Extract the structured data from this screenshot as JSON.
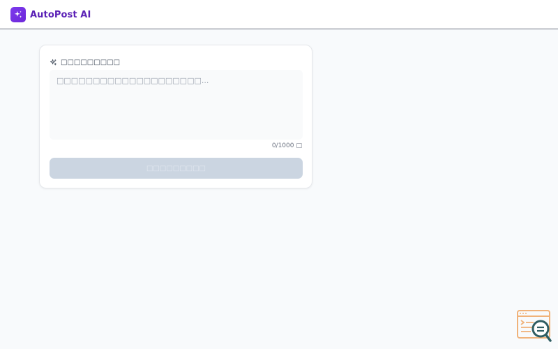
{
  "app": {
    "name": "AutoPost AI",
    "brand_color": "#6d28d9",
    "logo_icon": "sparkles-icon"
  },
  "composer": {
    "label": "□□□□□□□□□",
    "label_icon": "sparkles-icon",
    "placeholder": "□□□□□□□□□□□□□□□□□□□□...",
    "value": "",
    "char_count": "0/1000",
    "char_count_suffix": "□",
    "generate_label": "□□□□□□□□□",
    "generate_disabled": true,
    "button_color": "#cbd5e1"
  },
  "widget": {
    "icon": "code-search-icon",
    "color": "#f0b27a"
  }
}
